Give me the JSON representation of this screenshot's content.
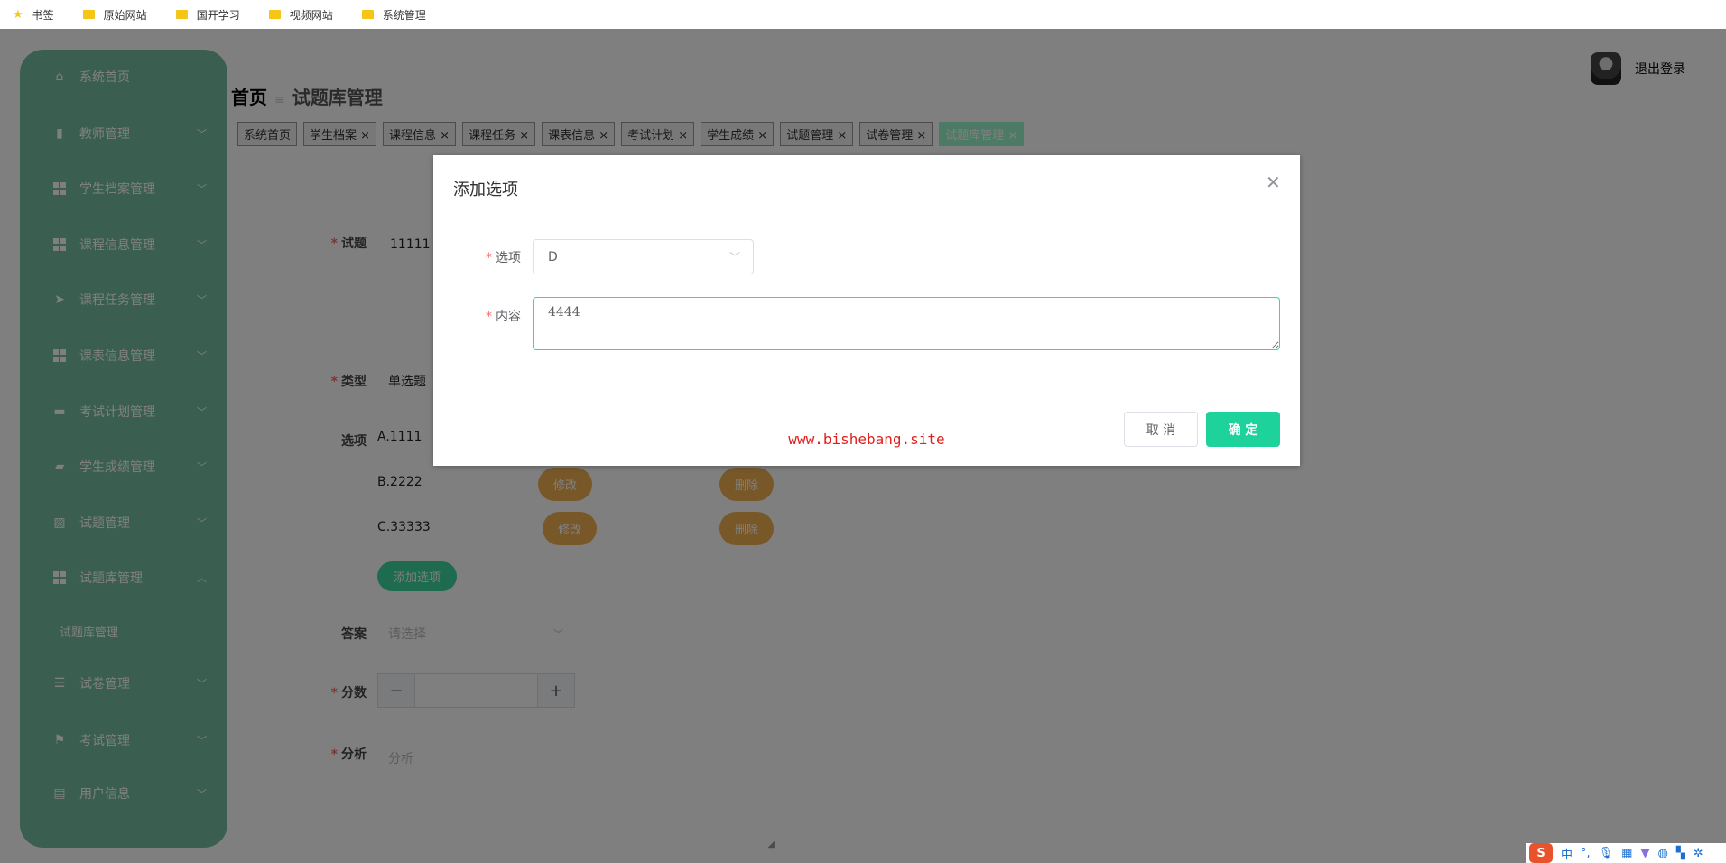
{
  "bookmarks": [
    {
      "label": "书签",
      "icon": "star-icon"
    },
    {
      "label": "原始网站",
      "icon": "folder-icon"
    },
    {
      "label": "国开学习",
      "icon": "folder-icon"
    },
    {
      "label": "视频网站",
      "icon": "folder-icon"
    },
    {
      "label": "系统管理",
      "icon": "folder-icon"
    }
  ],
  "sidebar": {
    "items": [
      {
        "label": "系统首页",
        "icon": "home-icon"
      },
      {
        "label": "教师管理",
        "icon": "clipboard-icon"
      },
      {
        "label": "学生档案管理",
        "icon": "grid-icon"
      },
      {
        "label": "课程信息管理",
        "icon": "grid-icon"
      },
      {
        "label": "课程任务管理",
        "icon": "send-icon"
      },
      {
        "label": "课表信息管理",
        "icon": "grid-icon"
      },
      {
        "label": "考试计划管理",
        "icon": "printer-icon"
      },
      {
        "label": "学生成绩管理",
        "icon": "briefcase-icon"
      },
      {
        "label": "试题管理",
        "icon": "chart-icon"
      },
      {
        "label": "试题库管理",
        "icon": "grid-icon"
      },
      {
        "label": "试卷管理",
        "icon": "sliders-icon"
      },
      {
        "label": "考试管理",
        "icon": "flag-icon"
      },
      {
        "label": "用户信息",
        "icon": "window-icon"
      }
    ],
    "subitem": "试题库管理"
  },
  "header": {
    "breadcrumb_home": "首页",
    "breadcrumb_current": "试题库管理",
    "logout": "退出登录"
  },
  "tabs": [
    "系统首页",
    "学生档案 ×",
    "课程信息 ×",
    "课程任务 ×",
    "课表信息 ×",
    "考试计划 ×",
    "学生成绩 ×",
    "试题管理 ×",
    "试卷管理 ×",
    "试题库管理 ×"
  ],
  "form": {
    "question_label": "试题",
    "question_value": "11111",
    "type_label": "类型",
    "type_value": "单选题",
    "options_label": "选项",
    "options": [
      "A.1111",
      "B.2222",
      "C.33333"
    ],
    "edit_label": "修改",
    "delete_label": "删除",
    "add_option": "添加选项",
    "answer_label": "答案",
    "answer_placeholder": "请选择",
    "score_label": "分数",
    "score_minus": "−",
    "score_plus": "+",
    "analysis_label": "分析",
    "analysis_placeholder": "分析"
  },
  "modal": {
    "title": "添加选项",
    "option_label": "选项",
    "option_value": "D",
    "content_label": "内容",
    "content_value": "4444",
    "cancel": "取 消",
    "confirm": "确 定",
    "watermark": "www.bishebang.site"
  },
  "ime": {
    "lang": "中",
    "punct": "°,"
  }
}
